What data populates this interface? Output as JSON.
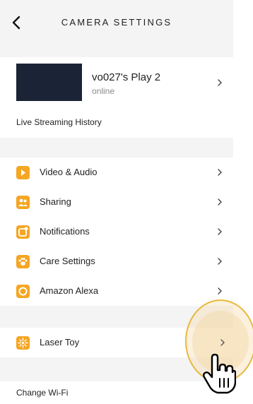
{
  "header": {
    "title": "CAMERA SETTINGS"
  },
  "device": {
    "name": "vo027's Play 2",
    "status": "online"
  },
  "live_streaming": "Live Streaming History",
  "menu": [
    {
      "label": "Video & Audio",
      "icon": "play-icon"
    },
    {
      "label": "Sharing",
      "icon": "people-icon"
    },
    {
      "label": "Notifications",
      "icon": "notification-icon"
    },
    {
      "label": "Care Settings",
      "icon": "paw-icon"
    },
    {
      "label": "Amazon Alexa",
      "icon": "alexa-icon"
    }
  ],
  "laser": {
    "label": "Laser Toy",
    "icon": "laser-icon"
  },
  "wifi": {
    "label": "Change Wi-Fi"
  },
  "colors": {
    "accent": "#f5a623",
    "header_bg": "#f4f4f4",
    "thumbnail": "#1b2436"
  }
}
